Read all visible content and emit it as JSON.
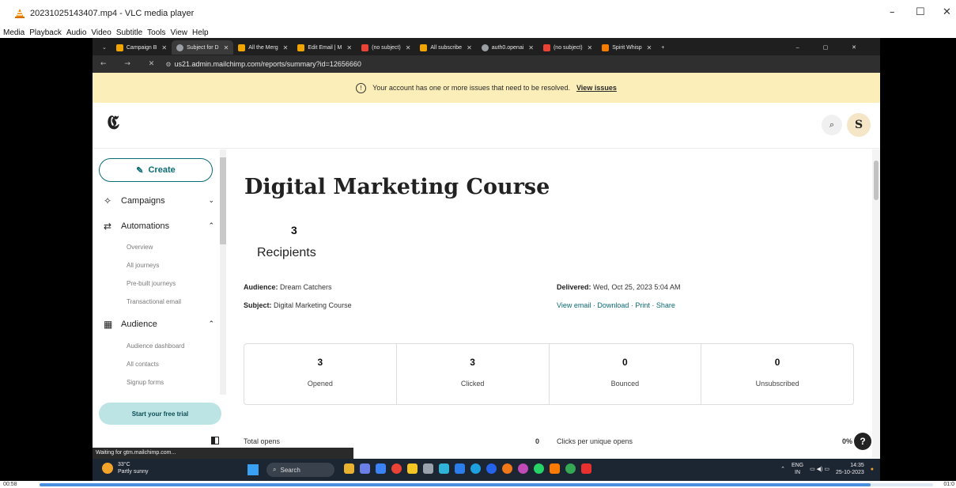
{
  "vlc": {
    "title": "20231025143407.mp4 - VLC media player",
    "menu": [
      "Media",
      "Playback",
      "Audio",
      "Video",
      "Subtitle",
      "Tools",
      "View",
      "Help"
    ],
    "time_elapsed": "00:58",
    "time_total": "01:0",
    "progress": 0.93,
    "controls": {
      "minimize": "–",
      "maximize": "☐",
      "close": "✕"
    }
  },
  "browser": {
    "tabs": [
      {
        "label": "Campaign B",
        "color": "#f0a500"
      },
      {
        "label": "Subject for D",
        "color": "#9aa0a6",
        "active": true
      },
      {
        "label": "All the Merg",
        "color": "#f0a500"
      },
      {
        "label": "Edit Email | M",
        "color": "#f0a500"
      },
      {
        "label": "(no subject)",
        "color": "#ea4335"
      },
      {
        "label": "All subscribe",
        "color": "#f0a500"
      },
      {
        "label": "auth0.openai",
        "color": "#9aa0a6"
      },
      {
        "label": "(no subject)",
        "color": "#ea4335"
      },
      {
        "label": "Spirit Whisp",
        "color": "#f57c00"
      }
    ],
    "new_tab": "+",
    "url": "us21.admin.mailchimp.com/reports/summary?id=12656660",
    "notice_text": "Your account has one or more issues that need to be resolved.",
    "notice_link": "View issues",
    "status_text": "Waiting for gtm.mailchimp.com..."
  },
  "mailchimp": {
    "avatar_letter": "S",
    "sidebar": {
      "create_label": "Create",
      "campaigns": "Campaigns",
      "automations": "Automations",
      "automation_items": [
        "Overview",
        "All journeys",
        "Pre-built journeys",
        "Transactional email"
      ],
      "audience": "Audience",
      "audience_items": [
        "Audience dashboard",
        "All contacts",
        "Signup forms"
      ],
      "trial_label": "Start your free trial"
    },
    "report": {
      "title": "Digital Marketing Course",
      "recipients_count": "3",
      "recipients_label": "Recipients",
      "audience_label": "Audience:",
      "audience_value": "Dream Catchers",
      "subject_label": "Subject:",
      "subject_value": "Digital Marketing Course",
      "delivered_label": "Delivered:",
      "delivered_value": "Wed, Oct 25, 2023 5:04 AM",
      "links": "View email · Download · Print · Share",
      "stats": [
        {
          "value": "3",
          "label": "Opened"
        },
        {
          "value": "3",
          "label": "Clicked"
        },
        {
          "value": "0",
          "label": "Bounced"
        },
        {
          "value": "0",
          "label": "Unsubscribed"
        }
      ],
      "total_opens_label": "Total opens",
      "total_opens_value": "0",
      "clicks_per_unique_label": "Clicks per unique opens",
      "clicks_per_unique_value": "0%"
    }
  },
  "taskbar": {
    "temp": "33°C",
    "weather": "Partly sunny",
    "search": "Search",
    "lang": "ENG",
    "region": "IN",
    "time": "14:35",
    "date": "25-10-2023"
  }
}
